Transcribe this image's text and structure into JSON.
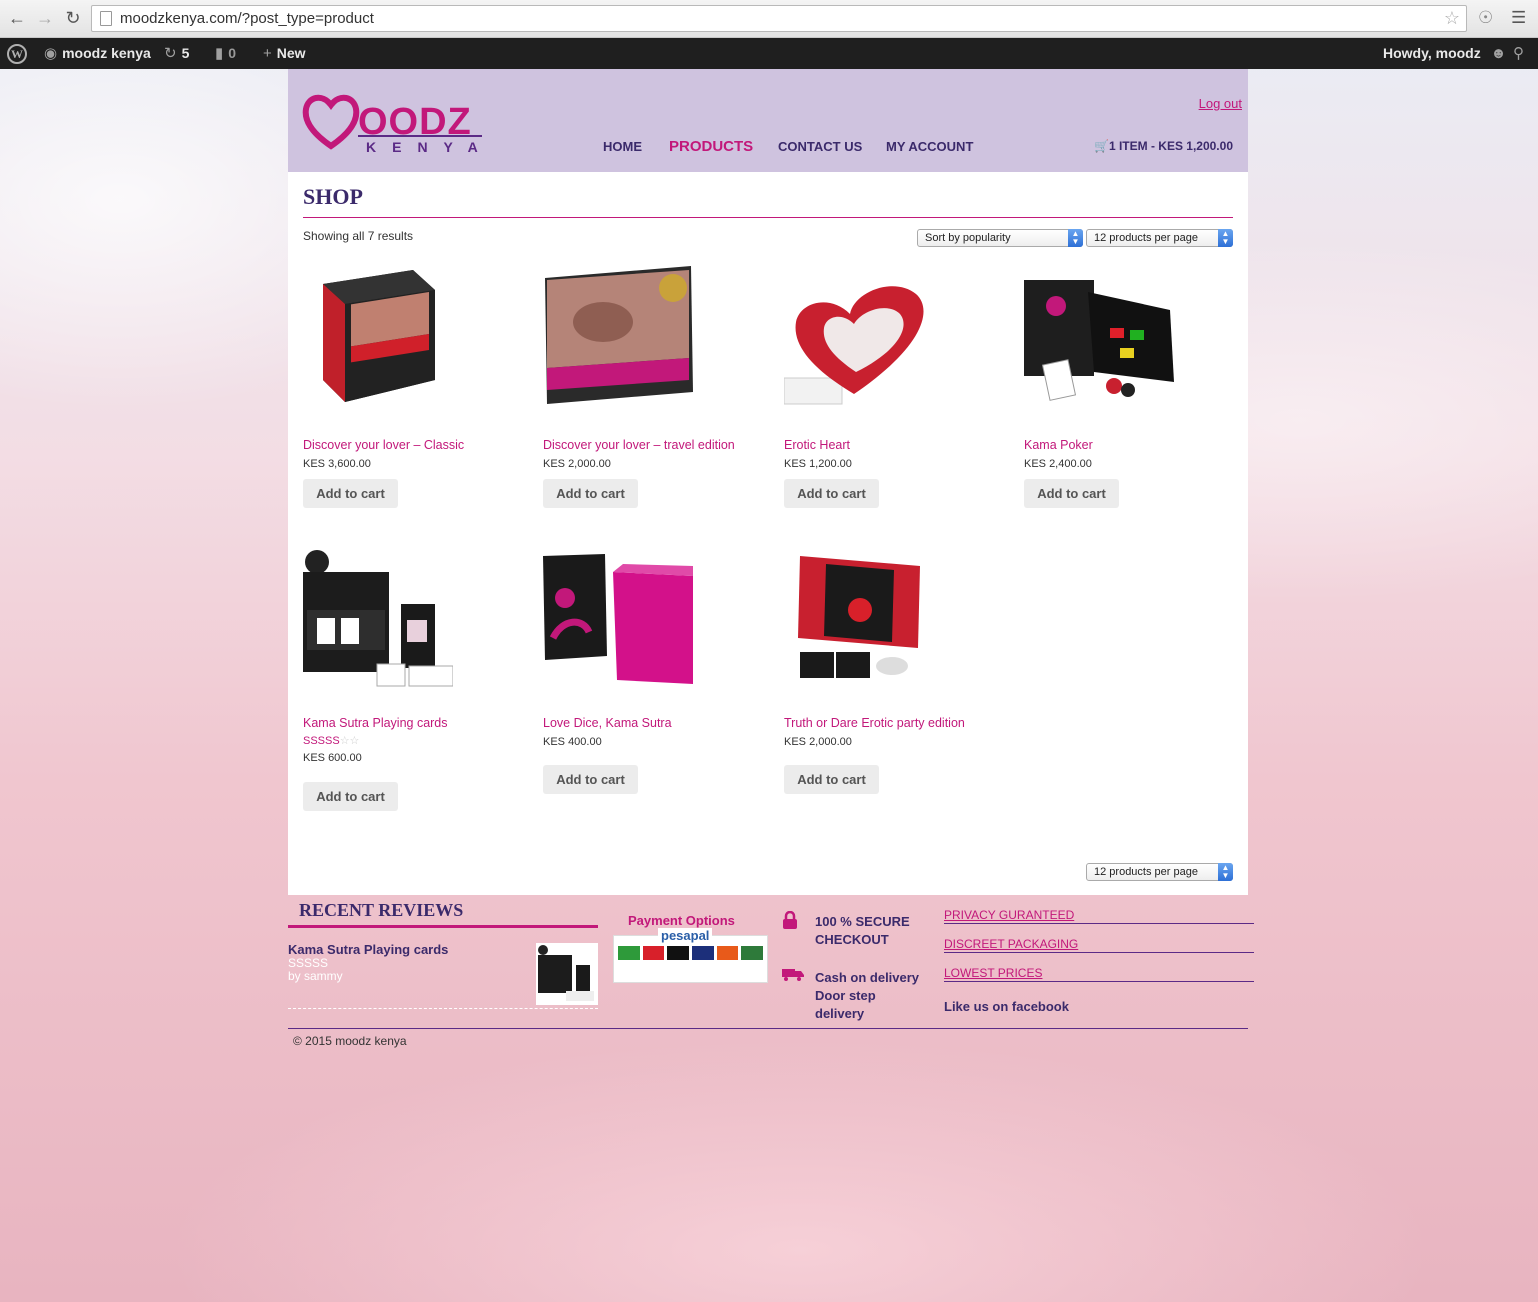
{
  "browser": {
    "url": "moodzkenya.com/?post_type=product"
  },
  "adminbar": {
    "site_name": "moodz kenya",
    "updates_count": "5",
    "comments_count": "0",
    "new_label": "New",
    "howdy": "Howdy, moodz"
  },
  "header": {
    "logo_word": "OODZ",
    "logo_sub": "KENYA",
    "logout": "Log out",
    "nav": {
      "home": "HOME",
      "products": "PRODUCTS",
      "contact": "CONTACT US",
      "account": "MY ACCOUNT"
    },
    "cart": "1 ITEM - KES 1,200.00"
  },
  "shop": {
    "title": "SHOP",
    "result_count": "Showing all 7 results",
    "sort": "Sort by popularity",
    "per_page": "12 products per page",
    "per_page_bottom": "12 products per page",
    "add_to_cart": "Add to cart",
    "products": [
      {
        "name": "Discover your lover – Classic",
        "price": "KES 3,600.00"
      },
      {
        "name": "Discover your lover – travel edition",
        "price": "KES 2,000.00"
      },
      {
        "name": "Erotic Heart",
        "price": "KES 1,200.00"
      },
      {
        "name": "Kama Poker",
        "price": "KES 2,400.00"
      },
      {
        "name": "Kama Sutra Playing cards",
        "price": "KES 600.00",
        "rating": "SSSSS"
      },
      {
        "name": "Love Dice, Kama Sutra",
        "price": "KES 400.00"
      },
      {
        "name": "Truth or Dare Erotic party edition",
        "price": "KES 2,000.00"
      }
    ]
  },
  "footer": {
    "recent_reviews_title": "RECENT REVIEWS",
    "review_product": "Kama Sutra Playing cards",
    "review_stars": "SSSSS",
    "review_by": "by sammy",
    "payment_title": "Payment Options",
    "payment_brand": "pesapal",
    "secure_line1": "100 % SECURE",
    "secure_line2": "CHECKOUT",
    "cod_line1": "Cash on delivery",
    "cod_line2": "Door step",
    "cod_line3": "delivery",
    "links": [
      "PRIVACY GURANTEED",
      "DISCREET PACKAGING",
      "LOWEST PRICES"
    ],
    "facebook": "Like us on facebook",
    "copyright": "© 2015 moodz kenya"
  },
  "colors": {
    "accent": "#c2187a",
    "purple": "#3b2a6b",
    "header_bg": "#cfc3df"
  }
}
